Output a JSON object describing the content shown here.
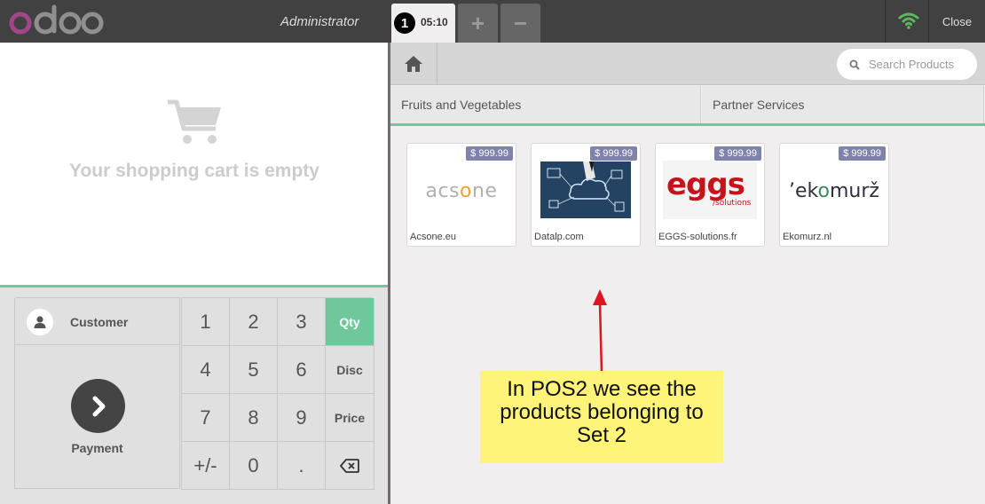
{
  "topbar": {
    "logo_text": "odoo",
    "user": "Administrator",
    "order": {
      "number": "1",
      "time": "05:10"
    },
    "add_order_label": "+",
    "remove_order_label": "−",
    "close_label": "Close",
    "connection_icon": "wifi-icon",
    "connection_color": "#5cb85c"
  },
  "cart": {
    "empty_message": "Your shopping cart is empty",
    "icon": "shopping-cart-icon"
  },
  "actionpad": {
    "customer_label": "Customer",
    "payment_label": "Payment"
  },
  "numpad": {
    "keys": [
      "1",
      "2",
      "3",
      "Qty",
      "4",
      "5",
      "6",
      "Disc",
      "7",
      "8",
      "9",
      "Price",
      "+/-",
      "0",
      ".",
      "backspace"
    ],
    "selected_mode": "Qty"
  },
  "search": {
    "placeholder": "Search Products"
  },
  "categories": [
    "Fruits and Vegetables",
    "Partner Services"
  ],
  "products": [
    {
      "name": "Acsone.eu",
      "price": "$ 999.99",
      "logo": "acsone"
    },
    {
      "name": "Datalp.com",
      "price": "$ 999.99",
      "logo": "datalp"
    },
    {
      "name": "EGGS-solutions.fr",
      "price": "$ 999.99",
      "logo": "eggs"
    },
    {
      "name": "Ekomurz.nl",
      "price": "$ 999.99",
      "logo": "ekomurz"
    }
  ],
  "annotation": {
    "lines": [
      "In POS2 we see the",
      "products belonging to",
      "Set 2"
    ],
    "arrow_color": "#e0141e",
    "background": "#fff47a"
  },
  "colors": {
    "accent": "#6ec89b",
    "topbar": "#414141",
    "price_badge": "#7f82ac"
  }
}
